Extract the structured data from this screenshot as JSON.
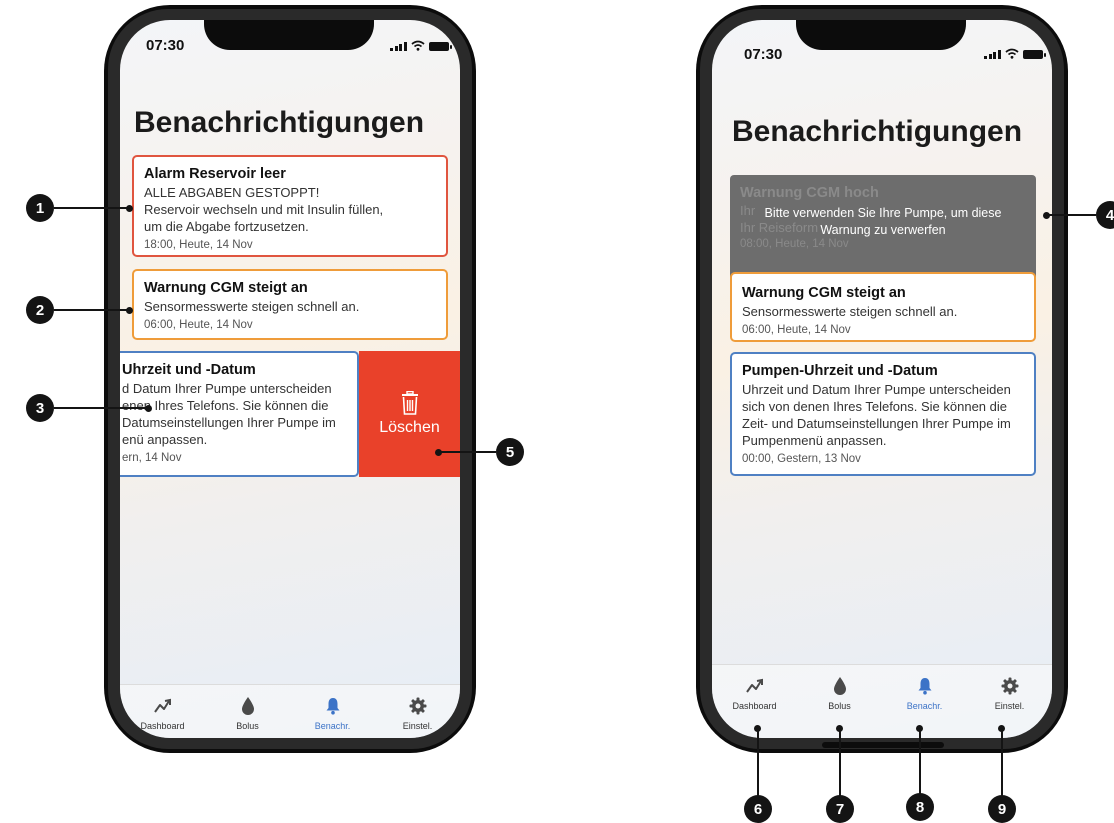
{
  "left_phone": {
    "status_time": "07:30",
    "page_title": "Benachrichtigungen",
    "cards": [
      {
        "title": "Alarm Reservoir leer",
        "lines": [
          "ALLE ABGABEN GESTOPPT!",
          "Reservoir wechseln und mit Insulin füllen,",
          "um die Abgabe fortzusetzen."
        ],
        "time": "18:00, Heute, 14 Nov",
        "color": "#e0553f"
      },
      {
        "title": "Warnung CGM steigt an",
        "lines": [
          "Sensormesswerte steigen schnell an."
        ],
        "time": "06:00, Heute, 14 Nov",
        "color": "#ef9c3a"
      },
      {
        "title": "Uhrzeit und -Datum",
        "lines": [
          "d Datum Ihrer Pumpe unterscheiden",
          "enen Ihres Telefons. Sie können die",
          "Datumseinstellungen Ihrer Pumpe im",
          "enü anpassen."
        ],
        "time": "ern, 14 Nov",
        "color": "#4f80c3"
      }
    ],
    "delete_label": "Löschen",
    "delete_color": "#e9412a"
  },
  "right_phone": {
    "status_time": "07:30",
    "page_title": "Benachrichtigungen",
    "overlay": {
      "ghost_title": "Warnung CGM hoch",
      "ghost_lines": [
        "Ihr",
        "Ihr Reiseform"
      ],
      "ghost_time": "08:00, Heute, 14 Nov",
      "message_line1": "Bitte verwenden Sie Ihre Pumpe, um diese",
      "message_line2": "Warnung zu verwerfen"
    },
    "cards": [
      {
        "title": "Warnung CGM steigt an",
        "lines": [
          "Sensormesswerte steigen schnell an."
        ],
        "time": "06:00, Heute, 14 Nov",
        "color": "#ef9c3a"
      },
      {
        "title": "Pumpen-Uhrzeit und -Datum",
        "lines": [
          "Uhrzeit und Datum Ihrer Pumpe unterscheiden",
          "sich von denen Ihres Telefons. Sie können die",
          "Zeit- und Datumseinstellungen Ihrer Pumpe im",
          "Pumpenmenü anpassen."
        ],
        "time": "00:00, Gestern, 13 Nov",
        "color": "#4f80c3"
      }
    ]
  },
  "tabs": [
    {
      "label": "Dashboard",
      "icon": "trend-icon"
    },
    {
      "label": "Bolus",
      "icon": "drop-icon"
    },
    {
      "label": "Benachr.",
      "icon": "bell-icon",
      "active": true
    },
    {
      "label": "Einstel.",
      "icon": "gear-icon"
    }
  ],
  "accent_color": "#3c73c7",
  "callouts": [
    "1",
    "2",
    "3",
    "4",
    "5",
    "6",
    "7",
    "8",
    "9"
  ]
}
